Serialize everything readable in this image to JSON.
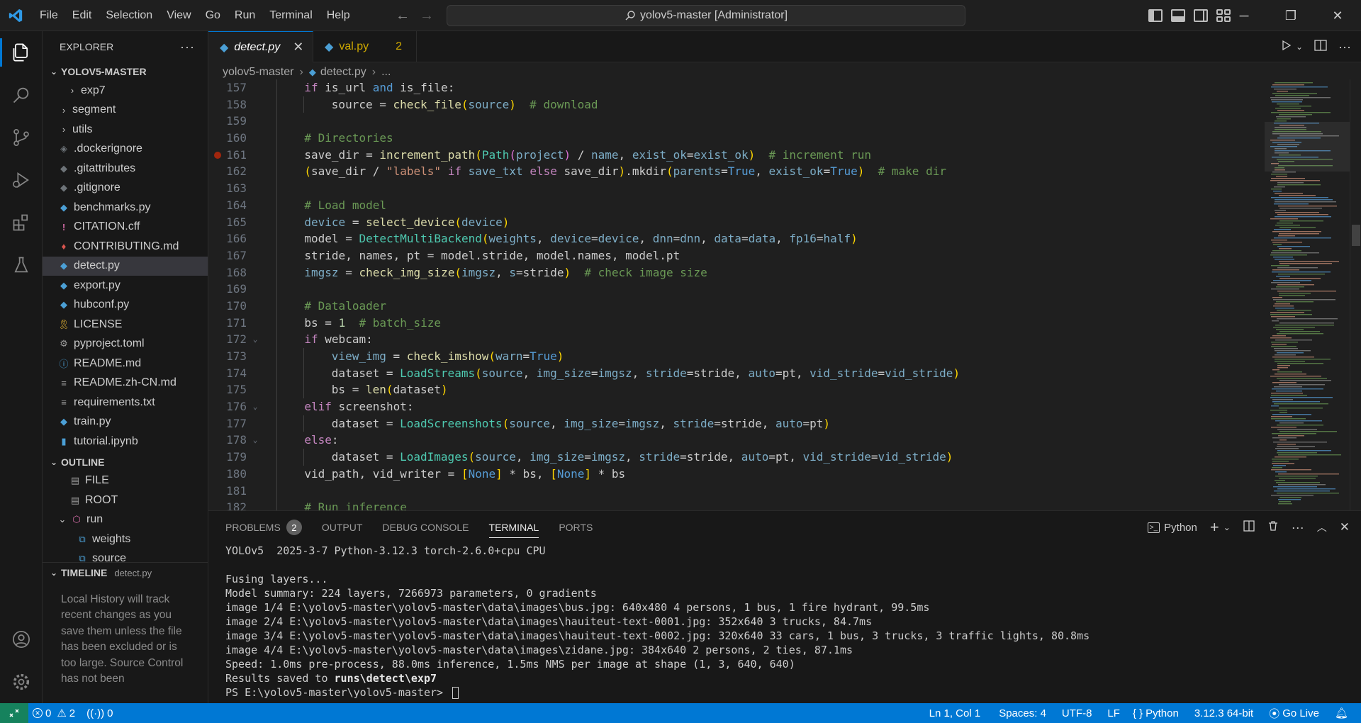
{
  "menubar": [
    "File",
    "Edit",
    "Selection",
    "View",
    "Go",
    "Run",
    "Terminal",
    "Help"
  ],
  "command_center": "yolov5-master [Administrator]",
  "sidebar": {
    "title": "EXPLORER",
    "project": "YOLOV5-MASTER",
    "tree": [
      {
        "label": "exp7",
        "type": "folder",
        "indent": 1
      },
      {
        "label": "segment",
        "type": "folder",
        "indent": 0
      },
      {
        "label": "utils",
        "type": "folder",
        "indent": 0
      },
      {
        "label": ".dockerignore",
        "type": "docker"
      },
      {
        "label": ".gitattributes",
        "type": "git"
      },
      {
        "label": ".gitignore",
        "type": "git"
      },
      {
        "label": "benchmarks.py",
        "type": "py"
      },
      {
        "label": "CITATION.cff",
        "type": "cff"
      },
      {
        "label": "CONTRIBUTING.md",
        "type": "md"
      },
      {
        "label": "detect.py",
        "type": "py",
        "selected": true
      },
      {
        "label": "export.py",
        "type": "py"
      },
      {
        "label": "hubconf.py",
        "type": "py"
      },
      {
        "label": "LICENSE",
        "type": "license"
      },
      {
        "label": "pyproject.toml",
        "type": "gear"
      },
      {
        "label": "README.md",
        "type": "info"
      },
      {
        "label": "README.zh-CN.md",
        "type": "lines"
      },
      {
        "label": "requirements.txt",
        "type": "lines"
      },
      {
        "label": "train.py",
        "type": "py"
      },
      {
        "label": "tutorial.ipynb",
        "type": "nb"
      }
    ],
    "outline": {
      "title": "OUTLINE",
      "items": [
        {
          "label": "FILE",
          "kind": "file"
        },
        {
          "label": "ROOT",
          "kind": "root"
        },
        {
          "label": "run",
          "kind": "method"
        },
        {
          "label": "weights",
          "kind": "var"
        },
        {
          "label": "source",
          "kind": "var"
        }
      ]
    },
    "timeline": {
      "title": "TIMELINE",
      "file": "detect.py",
      "message": "Local History will track recent changes as you save them unless the file has been excluded or is too large. Source Control has not been"
    }
  },
  "tabs": [
    {
      "label": "detect.py",
      "active": true
    },
    {
      "label": "val.py",
      "badge": "2"
    }
  ],
  "breadcrumb": [
    "yolov5-master",
    "detect.py",
    "..."
  ],
  "code_lines": [
    {
      "n": "157",
      "indent": 1,
      "html": "<span class='kw2'>if</span> is_url <span class='kw'>and</span> is_file:"
    },
    {
      "n": "158",
      "indent": 2,
      "html": "source = <span class='fn'>check_file</span><span class='brk'>(</span><span class='prm'>source</span><span class='brk'>)</span>  <span class='cm'># download</span>"
    },
    {
      "n": "159",
      "indent": 1,
      "html": ""
    },
    {
      "n": "160",
      "indent": 1,
      "html": "<span class='cm'># Directories</span>"
    },
    {
      "n": "161",
      "indent": 1,
      "bp": true,
      "html": "save_dir = <span class='fn'>increment_path</span><span class='brk'>(</span><span class='cls'>Path</span><span class='brk2'>(</span><span class='prm'>project</span><span class='brk2'>)</span> / <span class='prm'>name</span>, <span class='prm'>exist_ok</span>=<span class='prm'>exist_ok</span><span class='brk'>)</span>  <span class='cm'># increment run</span>"
    },
    {
      "n": "162",
      "indent": 1,
      "html": "<span class='brk'>(</span>save_dir / <span class='str'>\"labels\"</span> <span class='kw2'>if</span> <span class='prm'>save_txt</span> <span class='kw2'>else</span> save_dir<span class='brk'>)</span>.mkdir<span class='brk'>(</span><span class='prm'>parents</span>=<span class='kw'>True</span>, <span class='prm'>exist_ok</span>=<span class='kw'>True</span><span class='brk'>)</span>  <span class='cm'># make dir</span>"
    },
    {
      "n": "163",
      "indent": 1,
      "html": ""
    },
    {
      "n": "164",
      "indent": 1,
      "html": "<span class='cm'># Load model</span>"
    },
    {
      "n": "165",
      "indent": 1,
      "html": "<span class='prm'>device</span> = <span class='fn'>select_device</span><span class='brk'>(</span><span class='prm'>device</span><span class='brk'>)</span>"
    },
    {
      "n": "166",
      "indent": 1,
      "html": "model = <span class='cls'>DetectMultiBackend</span><span class='brk'>(</span><span class='prm'>weights</span>, <span class='prm'>device</span>=<span class='prm'>device</span>, <span class='prm'>dnn</span>=<span class='prm'>dnn</span>, <span class='prm'>data</span>=<span class='prm'>data</span>, <span class='prm'>fp16</span>=<span class='prm'>half</span><span class='brk'>)</span>"
    },
    {
      "n": "167",
      "indent": 1,
      "html": "stride, names, pt = model.stride, model.names, model.pt"
    },
    {
      "n": "168",
      "indent": 1,
      "html": "<span class='prm'>imgsz</span> = <span class='fn'>check_img_size</span><span class='brk'>(</span><span class='prm'>imgsz</span>, <span class='prm'>s</span>=stride<span class='brk'>)</span>  <span class='cm'># check image size</span>"
    },
    {
      "n": "169",
      "indent": 1,
      "html": ""
    },
    {
      "n": "170",
      "indent": 1,
      "html": "<span class='cm'># Dataloader</span>"
    },
    {
      "n": "171",
      "indent": 1,
      "html": "bs = <span class='num'>1</span>  <span class='cm'># batch_size</span>"
    },
    {
      "n": "172",
      "indent": 1,
      "fold": true,
      "html": "<span class='kw2'>if</span> webcam:"
    },
    {
      "n": "173",
      "indent": 2,
      "html": "<span class='prm'>view_img</span> = <span class='fn'>check_imshow</span><span class='brk'>(</span><span class='prm'>warn</span>=<span class='kw'>True</span><span class='brk'>)</span>"
    },
    {
      "n": "174",
      "indent": 2,
      "html": "dataset = <span class='cls'>LoadStreams</span><span class='brk'>(</span><span class='prm'>source</span>, <span class='prm'>img_size</span>=<span class='prm'>imgsz</span>, <span class='prm'>stride</span>=stride, <span class='prm'>auto</span>=pt, <span class='prm'>vid_stride</span>=<span class='prm'>vid_stride</span><span class='brk'>)</span>"
    },
    {
      "n": "175",
      "indent": 2,
      "html": "bs = <span class='fn'>len</span><span class='brk'>(</span>dataset<span class='brk'>)</span>"
    },
    {
      "n": "176",
      "indent": 1,
      "fold": true,
      "html": "<span class='kw2'>elif</span> screenshot:"
    },
    {
      "n": "177",
      "indent": 2,
      "html": "dataset = <span class='cls'>LoadScreenshots</span><span class='brk'>(</span><span class='prm'>source</span>, <span class='prm'>img_size</span>=<span class='prm'>imgsz</span>, <span class='prm'>stride</span>=stride, <span class='prm'>auto</span>=pt<span class='brk'>)</span>"
    },
    {
      "n": "178",
      "indent": 1,
      "fold": true,
      "html": "<span class='kw2'>else</span>:"
    },
    {
      "n": "179",
      "indent": 2,
      "html": "dataset = <span class='cls'>LoadImages</span><span class='brk'>(</span><span class='prm'>source</span>, <span class='prm'>img_size</span>=<span class='prm'>imgsz</span>, <span class='prm'>stride</span>=stride, <span class='prm'>auto</span>=pt, <span class='prm'>vid_stride</span>=<span class='prm'>vid_stride</span><span class='brk'>)</span>"
    },
    {
      "n": "180",
      "indent": 1,
      "html": "vid_path, vid_writer = <span class='brk'>[</span><span class='kw'>None</span><span class='brk'>]</span> * bs, <span class='brk'>[</span><span class='kw'>None</span><span class='brk'>]</span> * bs"
    },
    {
      "n": "181",
      "indent": 1,
      "html": ""
    },
    {
      "n": "182",
      "indent": 1,
      "html": "<span class='cm'># Run inference</span>"
    }
  ],
  "panel": {
    "tabs": [
      {
        "label": "PROBLEMS",
        "badge": "2"
      },
      {
        "label": "OUTPUT"
      },
      {
        "label": "DEBUG CONSOLE"
      },
      {
        "label": "TERMINAL",
        "active": true
      },
      {
        "label": "PORTS"
      }
    ],
    "terminal_profile": "Python",
    "terminal_lines": [
      "YOLOv5  2025-3-7 Python-3.12.3 torch-2.6.0+cpu CPU",
      "",
      "Fusing layers...",
      "Model summary: 224 layers, 7266973 parameters, 0 gradients",
      "image 1/4 E:\\yolov5-master\\yolov5-master\\data\\images\\bus.jpg: 640x480 4 persons, 1 bus, 1 fire hydrant, 99.5ms",
      "image 2/4 E:\\yolov5-master\\yolov5-master\\data\\images\\hauiteut-text-0001.jpg: 352x640 3 trucks, 84.7ms",
      "image 3/4 E:\\yolov5-master\\yolov5-master\\data\\images\\hauiteut-text-0002.jpg: 320x640 33 cars, 1 bus, 3 trucks, 3 traffic lights, 80.8ms",
      "image 4/4 E:\\yolov5-master\\yolov5-master\\data\\images\\zidane.jpg: 384x640 2 persons, 2 ties, 87.1ms",
      "Speed: 1.0ms pre-process, 88.0ms inference, 1.5ms NMS per image at shape (1, 3, 640, 640)"
    ],
    "results_prefix": "Results saved to ",
    "results_path": "runs\\detect\\exp7",
    "prompt": "PS E:\\yolov5-master\\yolov5-master> "
  },
  "statusbar": {
    "errors": "0",
    "warnings": "2",
    "ports": "0",
    "position": "Ln 1, Col 1",
    "spaces": "Spaces: 4",
    "encoding": "UTF-8",
    "eol": "LF",
    "language": "Python",
    "interpreter": "3.12.3 64-bit",
    "golive": "Go Live"
  },
  "colors": {
    "accent": "#0078d4",
    "remote": "#16825d",
    "warning": "#cca700"
  }
}
